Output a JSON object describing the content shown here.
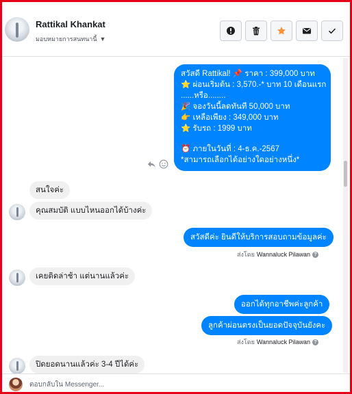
{
  "header": {
    "contact_name": "Rattikal Khankat",
    "assign_label": "มอบหมายการสนทนานี้",
    "actions": [
      {
        "name": "mark-spam-button",
        "icon": "exclamation-icon"
      },
      {
        "name": "delete-button",
        "icon": "trash-icon"
      },
      {
        "name": "star-button",
        "icon": "star-icon"
      },
      {
        "name": "mark-unread-button",
        "icon": "envelope-icon"
      },
      {
        "name": "mark-done-button",
        "icon": "check-icon"
      }
    ]
  },
  "messages": {
    "promo": {
      "lines": [
        "สวัสดี Rattikal! 📌 ราคา : 399,000 บาท",
        "⭐ ผ่อนเริ่มต้น : 3,570.-* บาท 10 เดือนแรก",
        "......หรือ........",
        "🎉 จองวันนี้ลดทันที 50,000 บาท",
        "👉 เหลือเพียง : 349,000 บาท",
        "⭐ รับรถ : 1999 บาท",
        "⏰ ภายในวันที่ : 4-ธ.ค.-2567",
        "*สามารถเลือกได้อย่างใดอย่างหนึ่ง*"
      ]
    },
    "in1": "สนใจค่ะ",
    "in2": "คุณสมบัติ แบบไหนออกได้บ้างค่ะ",
    "out1": "สวัสดีค่ะ  ยินดีให้บริการสอบถามข้อมูลค่ะ",
    "sent_by_label": "ส่งโดย",
    "agent_name": "Wannaluck Pilawan",
    "in3": "เคยติดล่าช้า แต่นานแล้วค่ะ",
    "out2": "ออกได้ทุกอาชีพค่ะลูกค้า",
    "out3": "ลูกค้าผ่อนตรงเป็นยอดปัจจุบันยังคะ",
    "in4": "ปิดยอดนานแล้วค่ะ 3-4 ปีได้ค่ะ"
  },
  "composer": {
    "placeholder": "ตอบกลับใน Messenger..."
  },
  "colors": {
    "accent": "#0084ff",
    "border": "#e5001a",
    "star": "#f7923b"
  }
}
